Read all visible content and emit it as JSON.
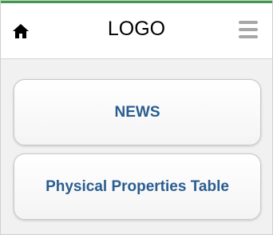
{
  "header": {
    "logo_text": "LOGO",
    "home_icon": "home-icon",
    "menu_icon": "hamburger-menu-icon",
    "accent_color": "#3f9b4b"
  },
  "nav": {
    "items": [
      {
        "label": "NEWS"
      },
      {
        "label": "Physical Properties Table"
      }
    ],
    "label_color": "#2a5d91"
  }
}
